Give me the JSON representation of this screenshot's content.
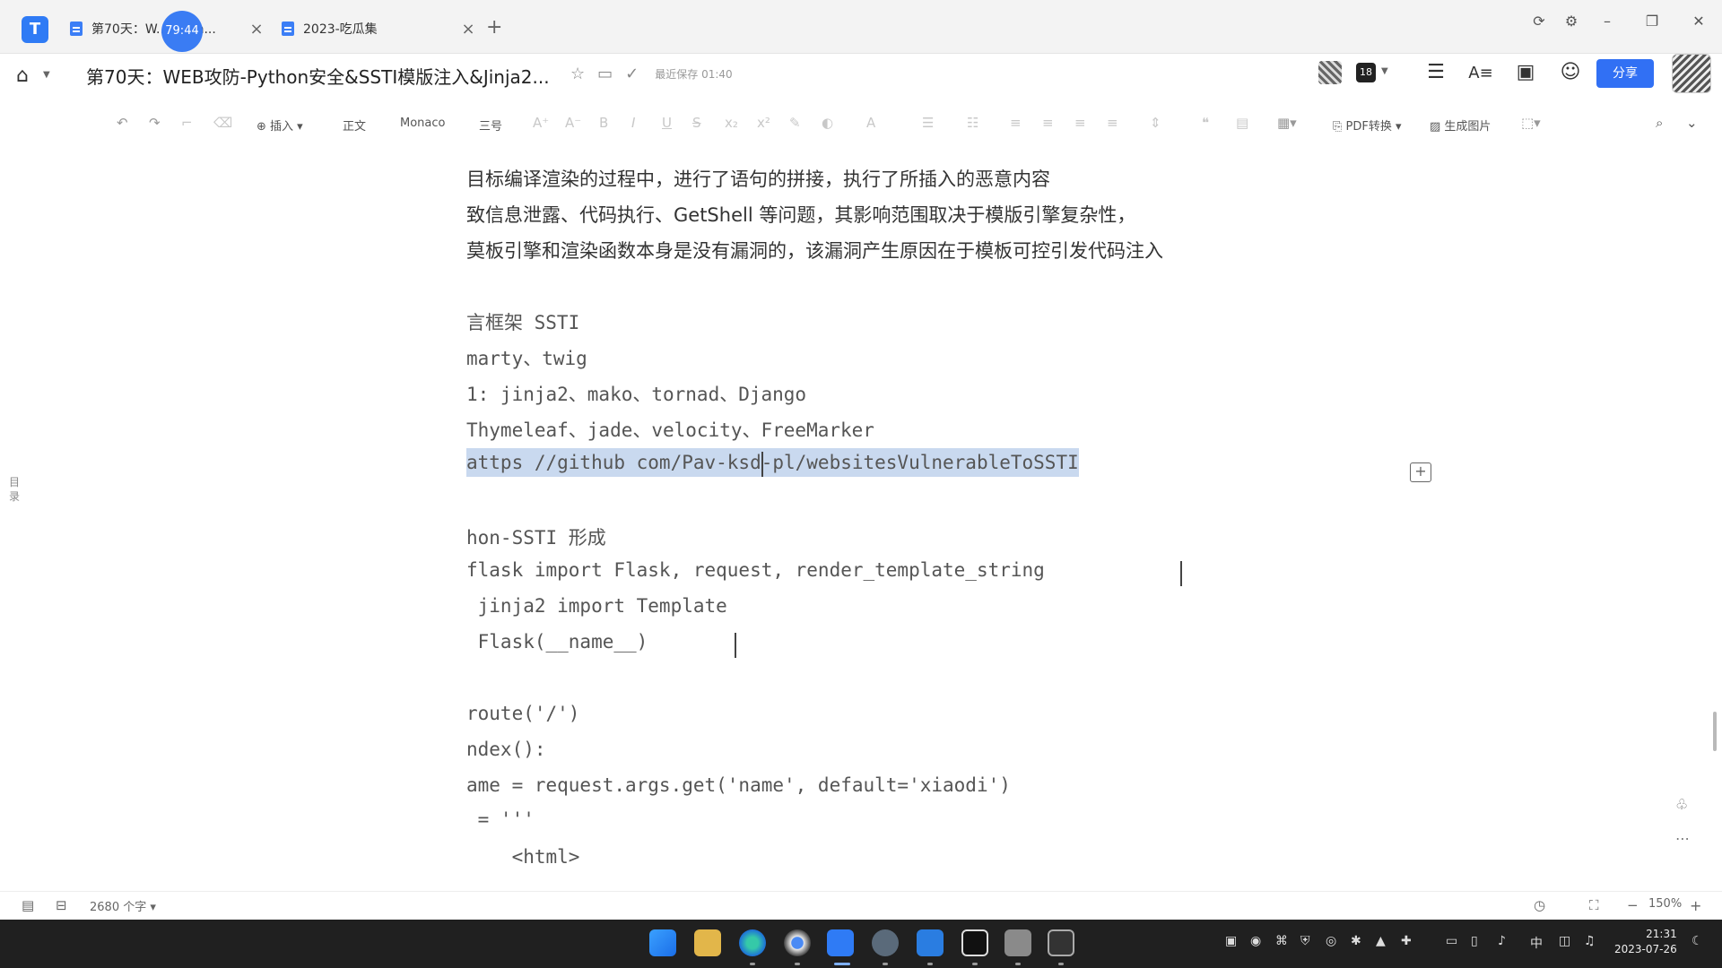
{
  "tabs": [
    {
      "label": "第70天：W...ython...",
      "active": true
    },
    {
      "label": "2023-吃瓜集",
      "active": false
    }
  ],
  "timer_badge": "79:44",
  "title": "第70天：WEB攻防-Python安全&SSTI模版注入&Jinja2...",
  "saved_text": "最近保存 01:40",
  "collab_count": "18",
  "share_label": "分享",
  "toolbar": {
    "insert_label": "插入",
    "body_style": "正文",
    "font": "Monaco",
    "font_size": "三号",
    "pdf_label": "PDF转换",
    "image_label": "生成图片"
  },
  "outline_label": "目录",
  "document_lines": [
    {
      "text": "目标编译渲染的过程中，进行了语句的拼接，执行了所插入的恶意内容",
      "style": "cjk"
    },
    {
      "text": "致信息泄露、代码执行、GetShell 等问题，其影响范围取决于模版引擎复杂性，",
      "style": "cjk"
    },
    {
      "text": "莫板引擎和渲染函数本身是没有漏洞的，该漏洞产生原因在于模板可控引发代码注入",
      "style": "cjk"
    },
    {
      "text": "",
      "style": "cjk"
    },
    {
      "text": "言框架 SSTI",
      "style": "mono"
    },
    {
      "text": "marty、twig",
      "style": "mono"
    },
    {
      "text": "1: jinja2、mako、tornad、Django",
      "style": "mono"
    },
    {
      "text": "Thymeleaf、jade、velocity、FreeMarker",
      "style": "mono"
    },
    {
      "text": "attps //github com/Pav-ksd-pl/websitesVulnerableToSSTI",
      "style": "link"
    },
    {
      "text": "",
      "style": "mono"
    },
    {
      "text": "hon-SSTI 形成",
      "style": "mono"
    },
    {
      "text": "flask import Flask, request, render_template_string",
      "style": "mono"
    },
    {
      "text": " jinja2 import Template",
      "style": "mono"
    },
    {
      "text": " Flask(__name__)",
      "style": "mono"
    },
    {
      "text": "",
      "style": "mono"
    },
    {
      "text": "route('/')",
      "style": "mono"
    },
    {
      "text": "ndex():",
      "style": "mono"
    },
    {
      "text": "ame = request.args.get('name', default='xiaodi')",
      "style": "mono"
    },
    {
      "text": " = '''",
      "style": "mono"
    },
    {
      "text": "    <html>",
      "style": "mono"
    }
  ],
  "status": {
    "word_count": "2680 个字",
    "zoom": "150%"
  },
  "clock": {
    "time": "21:31",
    "date": "2023-07-26"
  },
  "tray_ime": "中"
}
